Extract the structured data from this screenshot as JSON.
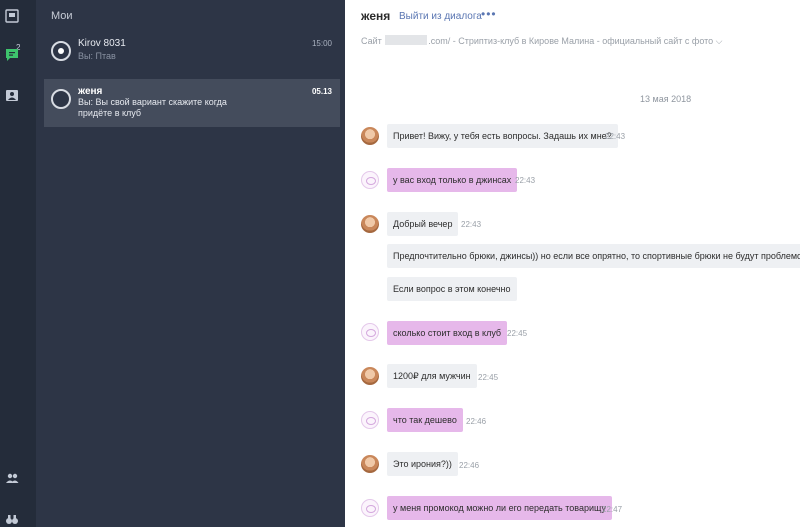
{
  "sidebar": {
    "badge_count": "2",
    "icons": [
      "dialog-icon",
      "chat-icon",
      "contacts-icon",
      "users-icon",
      "binoculars-icon"
    ]
  },
  "conversations": {
    "title": "Мои",
    "items": [
      {
        "name": "Kirov 8031",
        "preview": "Вы: Птав",
        "time": "15:00"
      },
      {
        "name": "женя",
        "preview": "Вы: Вы свой вариант скажите когда придёте в клуб",
        "time": "05.13"
      }
    ]
  },
  "chat": {
    "contact_name": "женя",
    "leave_link": "Выйти из диалога",
    "more_label": "•••",
    "site_prefix": "Сайт",
    "site_suffix": ".com/ - Стриптиз-клуб в Кирове Малина - официальный сайт с фото ⌵",
    "date_separator": "13 мая 2018",
    "messages": [
      {
        "text": "Привет! Вижу, у тебя есть вопросы. Задашь их мне?",
        "time": "22:43"
      },
      {
        "text": "у вас вход только в джинсах",
        "time": "22:43"
      },
      {
        "text": "Добрый вечер",
        "time": "22:43"
      },
      {
        "text": "Предпочтительно брюки, джинсы)) но если все опрятно, то спортивные брюки не будут проблемой",
        "time": ""
      },
      {
        "text": "Если вопрос в этом конечно",
        "time": ""
      },
      {
        "text": "сколько стоит вход в клуб",
        "time": "22:45"
      },
      {
        "text": "1200₽ для мужчин",
        "time": "22:45"
      },
      {
        "text": "что так дешево",
        "time": "22:46"
      },
      {
        "text": "Это ирония?))",
        "time": "22:46"
      },
      {
        "text": "у меня промокод можно ли его передать товарищу",
        "time": "22:47"
      }
    ]
  },
  "colors": {
    "rail": "#242c3a",
    "list": "#2d3546",
    "active": "#444c5c",
    "outgoing": "#e6b8ea",
    "incoming": "#eef0f3",
    "link": "#5a76b2"
  }
}
